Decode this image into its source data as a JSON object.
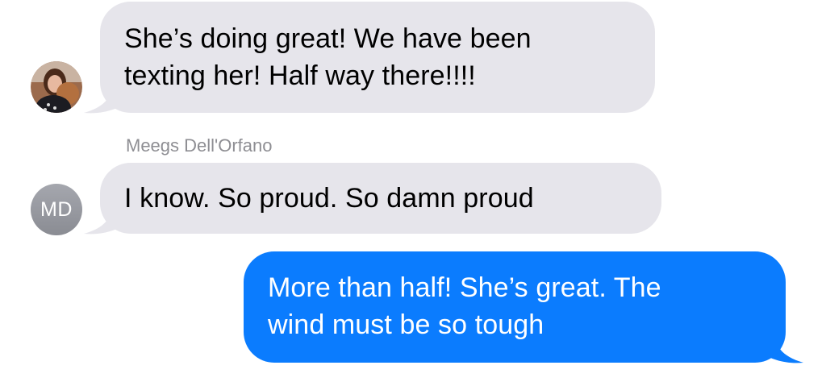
{
  "messages": [
    {
      "direction": "received",
      "lines": [
        "She’s doing great! We have been",
        "texting her! Half way there!!!!"
      ]
    },
    {
      "direction": "received",
      "sender": "Meegs Dell'Orfano",
      "avatar_initials": "MD",
      "lines": [
        "I know. So proud.  So damn proud"
      ]
    },
    {
      "direction": "sent",
      "lines": [
        "More than half! She’s great. The",
        "wind must be so tough"
      ]
    }
  ],
  "colors": {
    "received_bubble": "#e6e5eb",
    "sent_bubble": "#0b7cfe",
    "sender_name": "#8e8e93",
    "initials_avatar": "#9a9ca3"
  },
  "icons": {
    "first_avatar": "contact-photo-avatar"
  }
}
